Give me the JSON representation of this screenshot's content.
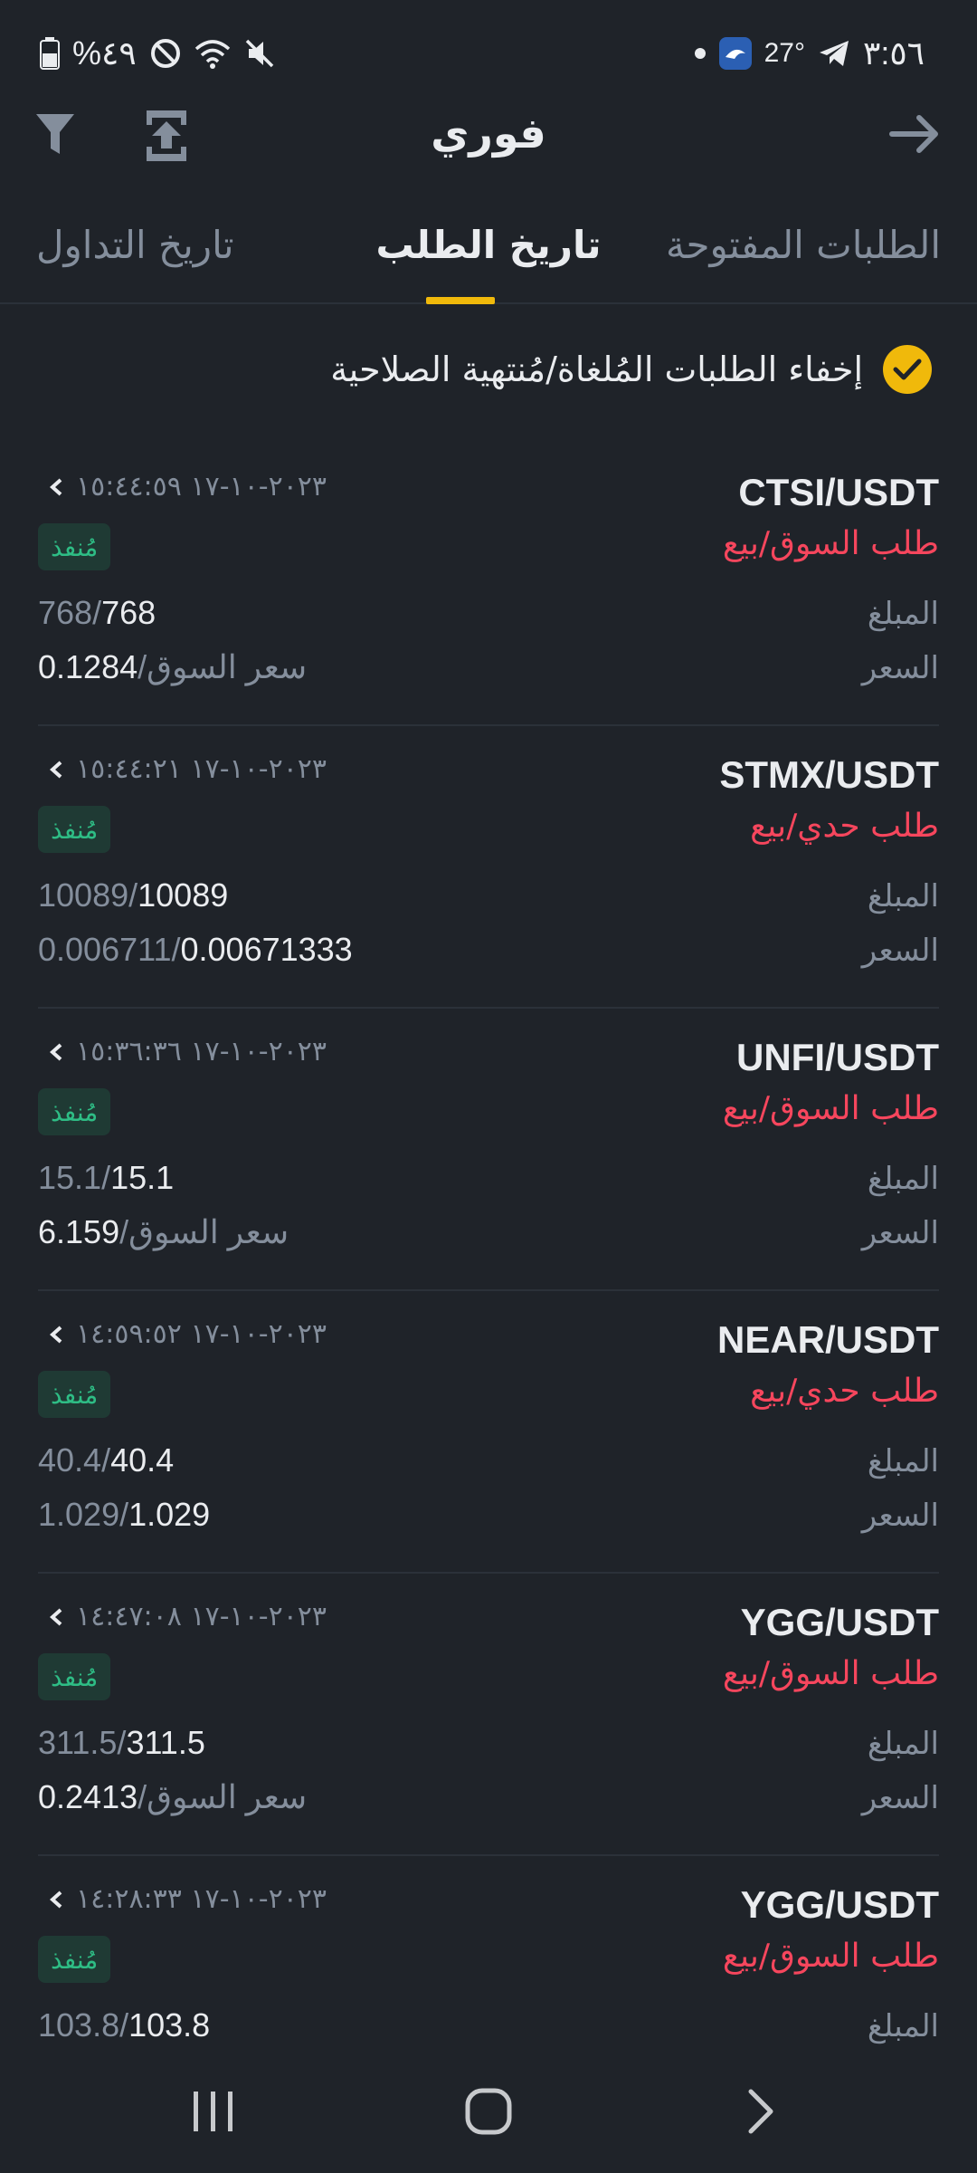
{
  "status_bar": {
    "time": "٣:٥٦",
    "temperature": "27°",
    "battery": "%٤٩"
  },
  "header": {
    "title": "فوري"
  },
  "tabs": [
    {
      "label": "الطلبات المفتوحة",
      "active": false
    },
    {
      "label": "تاريخ الطلب",
      "active": true
    },
    {
      "label": "تاريخ التداول",
      "active": false
    }
  ],
  "filter_toggle": {
    "label": "إخفاء الطلبات المُلغاة/مُنتهية الصلاحية",
    "checked": true
  },
  "labels": {
    "amount": "المبلغ",
    "price": "السعر"
  },
  "orders": [
    {
      "pair": "CTSI/USDT",
      "type": "طلب السوق/بيع",
      "datetime": "٢٠٢٣-١٠-١٧ ١٥:٤٤:٥٩",
      "status": "مُنفذ",
      "amount_filled": "768",
      "amount_total": "768",
      "price_avg": "0.1284",
      "price_order": "سعر السوق"
    },
    {
      "pair": "STMX/USDT",
      "type": "طلب حدي/بيع",
      "datetime": "٢٠٢٣-١٠-١٧ ١٥:٤٤:٢١",
      "status": "مُنفذ",
      "amount_filled": "10089",
      "amount_total": "10089",
      "price_avg": "0.00671333",
      "price_order": "0.006711"
    },
    {
      "pair": "UNFI/USDT",
      "type": "طلب السوق/بيع",
      "datetime": "٢٠٢٣-١٠-١٧ ١٥:٣٦:٣٦",
      "status": "مُنفذ",
      "amount_filled": "15.1",
      "amount_total": "15.1",
      "price_avg": "6.159",
      "price_order": "سعر السوق"
    },
    {
      "pair": "NEAR/USDT",
      "type": "طلب حدي/بيع",
      "datetime": "٢٠٢٣-١٠-١٧ ١٤:٥٩:٥٢",
      "status": "مُنفذ",
      "amount_filled": "40.4",
      "amount_total": "40.4",
      "price_avg": "1.029",
      "price_order": "1.029"
    },
    {
      "pair": "YGG/USDT",
      "type": "طلب السوق/بيع",
      "datetime": "٢٠٢٣-١٠-١٧ ١٤:٤٧:٠٨",
      "status": "مُنفذ",
      "amount_filled": "311.5",
      "amount_total": "311.5",
      "price_avg": "0.2413",
      "price_order": "سعر السوق"
    },
    {
      "pair": "YGG/USDT",
      "type": "طلب السوق/بيع",
      "datetime": "٢٠٢٣-١٠-١٧ ١٤:٢٨:٣٣",
      "status": "مُنفذ",
      "amount_filled": "103.8",
      "amount_total": "103.8",
      "price_avg": "",
      "price_order": ""
    }
  ],
  "colors": {
    "background": "#1f2329",
    "accent": "#f0b90b",
    "sell": "#f6465d",
    "filled": "#2ebd85"
  },
  "icons": [
    "battery-icon",
    "do-not-disturb-icon",
    "wifi-icon",
    "mute-icon",
    "dot-icon",
    "vpn-app-icon",
    "telegram-icon",
    "filter-icon",
    "export-icon",
    "back-arrow-icon",
    "checkmark-icon",
    "chevron-left-icon",
    "nav-recent-icon",
    "nav-home-icon",
    "nav-back-icon"
  ]
}
